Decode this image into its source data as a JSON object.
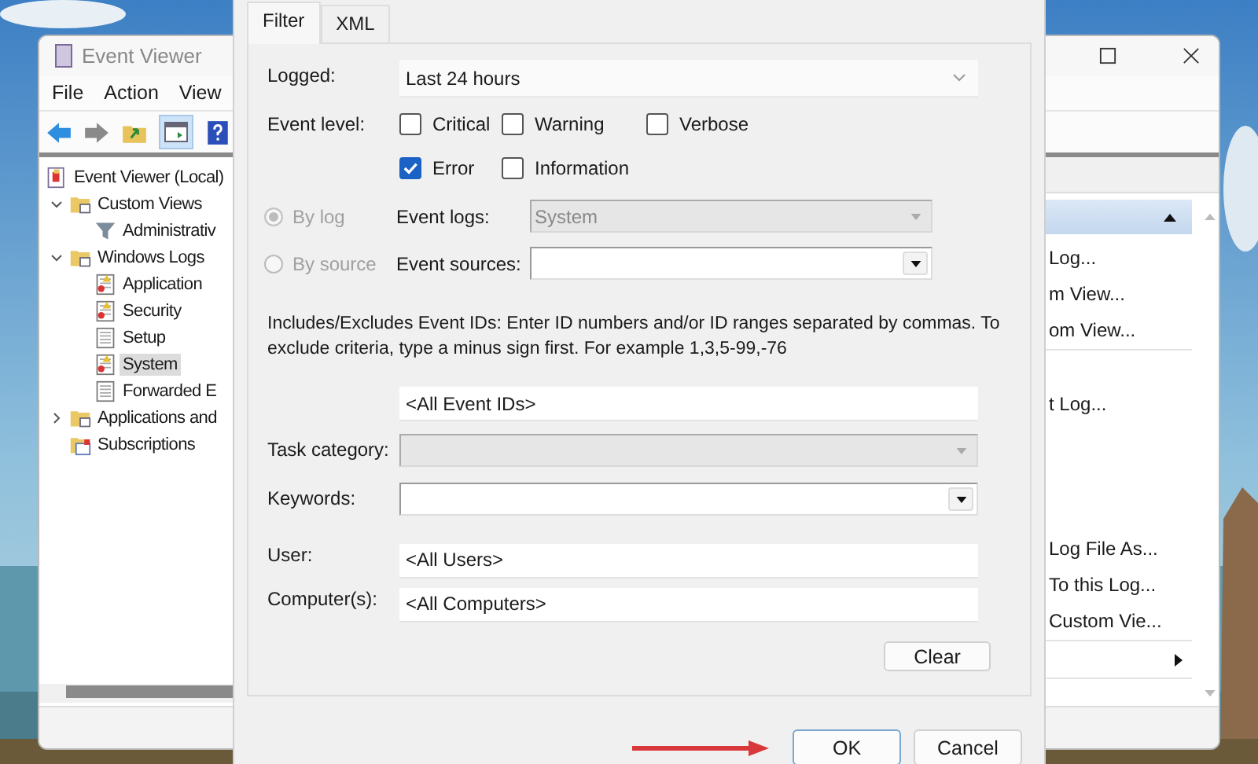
{
  "event_viewer": {
    "title": "Event Viewer",
    "menu": [
      "File",
      "Action",
      "View"
    ],
    "tree": [
      {
        "label": "Event Viewer (Local)",
        "kind": "root",
        "selected": false,
        "children": [
          {
            "label": "Custom Views",
            "kind": "folder",
            "expanded": true,
            "selected": false,
            "children": [
              {
                "label": "Administrativ",
                "kind": "filter",
                "selected": false
              }
            ]
          },
          {
            "label": "Windows Logs",
            "kind": "folder",
            "expanded": true,
            "selected": false,
            "children": [
              {
                "label": "Application",
                "kind": "log",
                "selected": false
              },
              {
                "label": "Security",
                "kind": "log",
                "selected": false
              },
              {
                "label": "Setup",
                "kind": "plainlog",
                "selected": false
              },
              {
                "label": "System",
                "kind": "log",
                "selected": true
              },
              {
                "label": "Forwarded E",
                "kind": "plainlog",
                "selected": false
              }
            ]
          },
          {
            "label": "Applications and",
            "kind": "folder",
            "expanded": false,
            "selected": false
          },
          {
            "label": "Subscriptions",
            "kind": "subscription",
            "selected": false
          }
        ]
      }
    ],
    "actions": [
      {
        "kind": "header"
      },
      {
        "kind": "item",
        "label": "Log..."
      },
      {
        "kind": "item",
        "label": "m View..."
      },
      {
        "kind": "item",
        "label": "om View..."
      },
      {
        "kind": "separator"
      },
      {
        "kind": "blank"
      },
      {
        "kind": "item",
        "label": "t Log..."
      },
      {
        "kind": "blank"
      },
      {
        "kind": "blank"
      },
      {
        "kind": "blank"
      },
      {
        "kind": "item",
        "label": "Log File As..."
      },
      {
        "kind": "item",
        "label": "To this Log..."
      },
      {
        "kind": "item",
        "label": "Custom Vie..."
      },
      {
        "kind": "separator"
      },
      {
        "kind": "submenu"
      },
      {
        "kind": "separator"
      }
    ]
  },
  "dialog": {
    "tabs": [
      {
        "label": "Filter",
        "selected": true
      },
      {
        "label": "XML",
        "selected": false
      }
    ],
    "logged": {
      "label": "Logged:",
      "value": "Last 24 hours"
    },
    "event_level": {
      "label": "Event level:",
      "options": [
        {
          "label": "Critical",
          "checked": false
        },
        {
          "label": "Warning",
          "checked": false
        },
        {
          "label": "Verbose",
          "checked": false
        },
        {
          "label": "Error",
          "checked": true
        },
        {
          "label": "Information",
          "checked": false
        }
      ]
    },
    "sources": [
      {
        "option": "By log",
        "selected": true,
        "disabled": true,
        "label": "Event logs:",
        "value": "System",
        "field_disabled": true
      },
      {
        "option": "By source",
        "selected": false,
        "disabled": true,
        "label": "Event sources:",
        "field_disabled": false
      }
    ],
    "hint": "Includes/Excludes Event IDs: Enter ID numbers and/or ID ranges separated by commas. To exclude criteria, type a minus sign first. For example 1,3,5-99,-76",
    "event_ids": {
      "value": "<All Event IDs>"
    },
    "fields": [
      {
        "label": "Task category:",
        "kind": "combo",
        "disabled": true
      },
      {
        "label": "Keywords:",
        "kind": "combo",
        "disabled": false
      },
      {
        "label": "User:",
        "kind": "text",
        "value": "<All Users>"
      },
      {
        "label": "Computer(s):",
        "kind": "text",
        "value": "<All Computers>"
      }
    ],
    "clear": "Clear",
    "ok": "OK",
    "cancel": "Cancel"
  }
}
